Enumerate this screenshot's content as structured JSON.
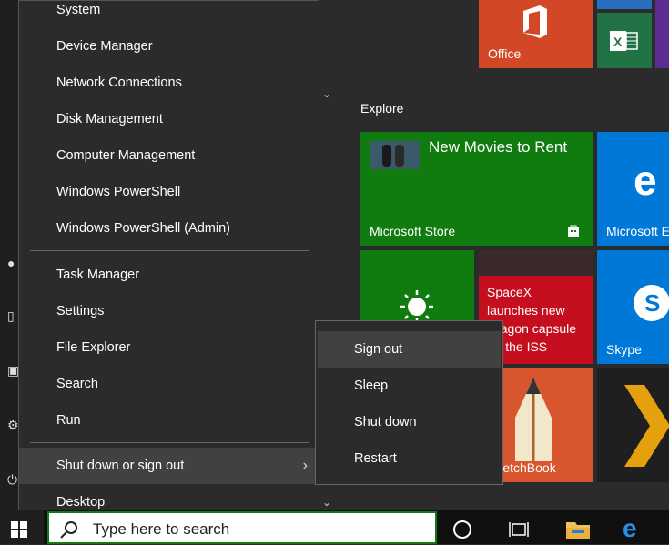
{
  "winx_menu": {
    "items_group1": [
      "System",
      "Device Manager",
      "Network Connections",
      "Disk Management",
      "Computer Management",
      "Windows PowerShell",
      "Windows PowerShell (Admin)"
    ],
    "items_group2": [
      "Task Manager",
      "Settings",
      "File Explorer",
      "Search",
      "Run"
    ],
    "shutdown_item": "Shut down or sign out",
    "desktop_item": "Desktop"
  },
  "shutdown_submenu": {
    "items": [
      "Sign out",
      "Sleep",
      "Shut down",
      "Restart"
    ]
  },
  "start_tiles": {
    "group_label": "Explore",
    "office": "Office",
    "store_title": "New Movies to Rent",
    "store_label": "Microsoft Store",
    "edge_label": "Microsoft Edge",
    "news_text": "SpaceX launches new Dragon capsule for the ISS",
    "skype_label": "Skype",
    "sketchbook_label": "SketchBook"
  },
  "taskbar": {
    "search_placeholder": "Type here to search"
  },
  "colors": {
    "accent": "#107c10",
    "menu_bg": "#2b2b2b",
    "menu_highlight": "#414141"
  },
  "icons": [
    "windows-logo-icon",
    "search-icon",
    "task-view-icon",
    "cortana-icon",
    "file-explorer-icon",
    "edge-icon",
    "office-icon",
    "excel-icon",
    "weather-sun-icon",
    "skype-icon",
    "plex-icon",
    "store-bag-icon"
  ]
}
